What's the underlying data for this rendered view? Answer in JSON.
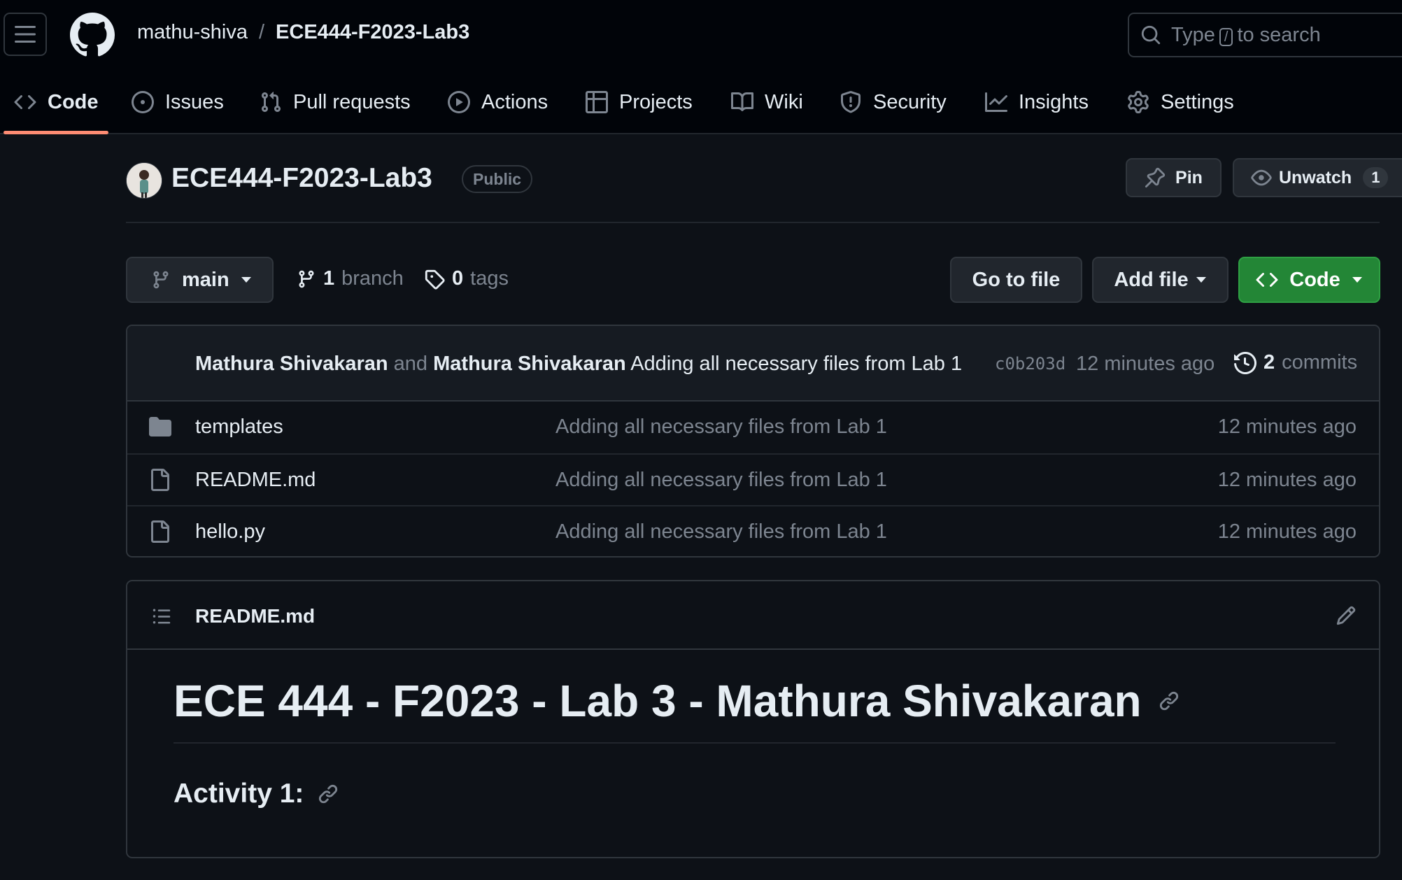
{
  "header": {
    "owner": "mathu-shiva",
    "separator": "/",
    "repo": "ECE444-F2023-Lab3",
    "search_prefix": "Type",
    "search_key": "/",
    "search_suffix": "to search"
  },
  "tabs": [
    {
      "label": "Code",
      "icon": "code-icon",
      "active": true
    },
    {
      "label": "Issues",
      "icon": "issue-opened-icon"
    },
    {
      "label": "Pull requests",
      "icon": "git-pull-request-icon"
    },
    {
      "label": "Actions",
      "icon": "play-icon"
    },
    {
      "label": "Projects",
      "icon": "table-icon"
    },
    {
      "label": "Wiki",
      "icon": "book-icon"
    },
    {
      "label": "Security",
      "icon": "shield-icon"
    },
    {
      "label": "Insights",
      "icon": "graph-icon"
    },
    {
      "label": "Settings",
      "icon": "gear-icon"
    }
  ],
  "repo": {
    "title": "ECE444-F2023-Lab3",
    "visibility": "Public",
    "pin_label": "Pin",
    "watch_label": "Unwatch",
    "watch_count": "1"
  },
  "branchbar": {
    "branch": "main",
    "branch_count": "1",
    "branch_word": "branch",
    "tag_count": "0",
    "tag_word": "tags",
    "go_to_file": "Go to file",
    "add_file": "Add file",
    "code": "Code"
  },
  "commit": {
    "author1": "Mathura Shivakaran",
    "and": "and",
    "author2": "Mathura Shivakaran",
    "message": "Adding all necessary files from Lab 1",
    "sha": "c0b203d",
    "time": "12 minutes ago",
    "count": "2",
    "count_word": "commits"
  },
  "files": [
    {
      "name": "templates",
      "type": "folder",
      "message": "Adding all necessary files from Lab 1",
      "time": "12 minutes ago"
    },
    {
      "name": "README.md",
      "type": "file",
      "message": "Adding all necessary files from Lab 1",
      "time": "12 minutes ago"
    },
    {
      "name": "hello.py",
      "type": "file",
      "message": "Adding all necessary files from Lab 1",
      "time": "12 minutes ago"
    }
  ],
  "readme": {
    "filename": "README.md",
    "h1": "ECE 444 - F2023 - Lab 3 - Mathura Shivakaran",
    "h2": "Activity 1:"
  },
  "colors": {
    "background": "#0d1117",
    "header": "#010409",
    "border": "#30363d",
    "muted": "#7d8590",
    "accent_underline": "#fd8c73",
    "code_button": "#238636"
  }
}
